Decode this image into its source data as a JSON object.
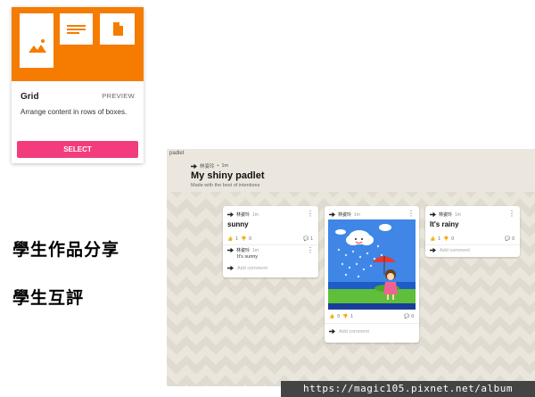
{
  "template_card": {
    "title": "Grid",
    "preview_label": "PREVIEW",
    "description": "Arrange content in rows of boxes.",
    "select_label": "SELECT",
    "banner_color": "#f57c00",
    "button_color": "#f23c7d"
  },
  "labels": {
    "share": "學生作品分享",
    "review": "學生互評"
  },
  "padlet": {
    "app_name": "padlet",
    "author": "林姿玲",
    "time": "1m",
    "title": "My shiny padlet",
    "subtitle": "Made with the best of intentions",
    "posts": [
      {
        "author": "林姿玲",
        "time": "1m",
        "text": "sunny",
        "likes": "1",
        "dislikes": "0",
        "comments": "1",
        "comment": {
          "author": "林姿玲",
          "time": "1m",
          "text": "It's sunny"
        },
        "add_comment": "Add comment"
      },
      {
        "author": "林姿玲",
        "time": "1m",
        "image": "cartoon-girl-umbrella-rain",
        "likes": "0",
        "dislikes": "1",
        "comments": "0",
        "add_comment": "Add comment"
      },
      {
        "author": "林姿玲",
        "time": "1m",
        "text": "It's rainy",
        "likes": "1",
        "dislikes": "0",
        "comments": "0",
        "add_comment": "Add comment"
      }
    ]
  },
  "watermark": "https://magic105.pixnet.net/album"
}
